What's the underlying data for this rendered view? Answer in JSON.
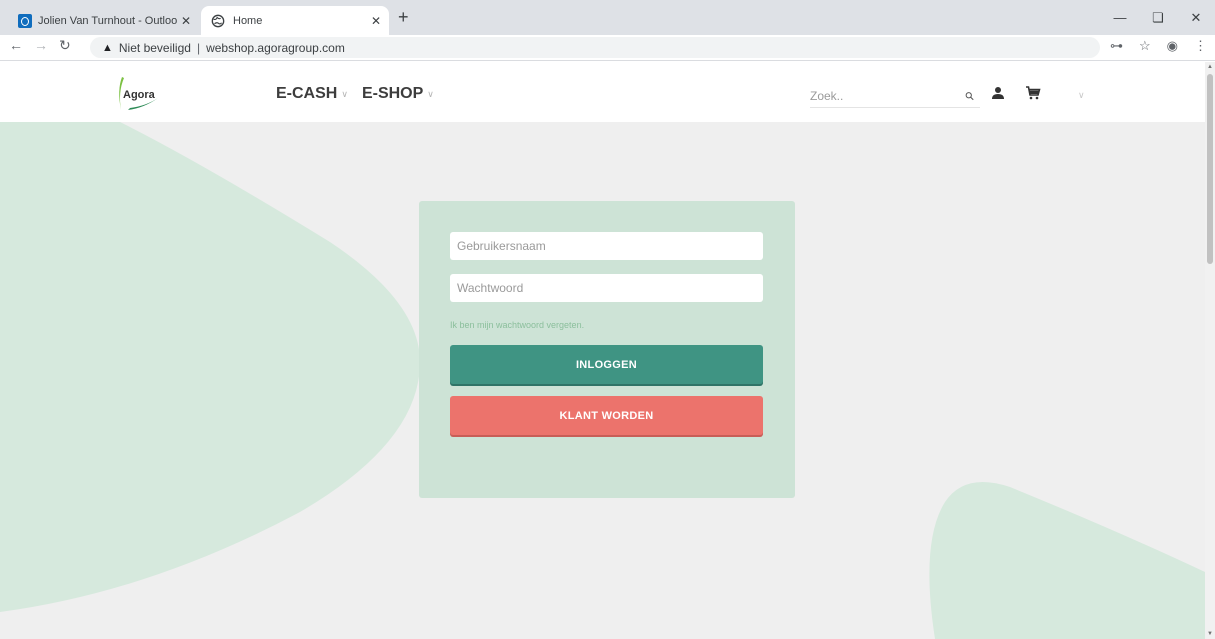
{
  "browser": {
    "tabs": [
      {
        "title": "Jolien Van Turnhout - Outlook W",
        "icon": "outlook-icon",
        "active": false
      },
      {
        "title": "Home",
        "icon": "globe-icon",
        "active": true
      }
    ],
    "close_glyph": "✕",
    "new_tab_glyph": "+",
    "security_label": "Niet beveiligd",
    "url": "webshop.agoragroup.com"
  },
  "header": {
    "logo_text": "Agora",
    "nav": [
      {
        "label": "E-CASH"
      },
      {
        "label": "E-SHOP"
      }
    ],
    "search": {
      "placeholder": "Zoek.."
    }
  },
  "login": {
    "username_placeholder": "Gebruikersnaam",
    "password_placeholder": "Wachtwoord",
    "forgot_link": "Ik ben mijn wachtwoord vergeten.",
    "login_button": "INLOGGEN",
    "register_button": "KLANT WORDEN"
  },
  "colors": {
    "page_background": "#efefef",
    "card_background": "#cde3d6",
    "shape_color": "#d6e9dd",
    "login_button": "#3f9483",
    "register_button": "#ec736c",
    "forgot_link": "#8bbf9c",
    "logo_green": "#7cc143",
    "logo_dark_green": "#2e8b57"
  }
}
